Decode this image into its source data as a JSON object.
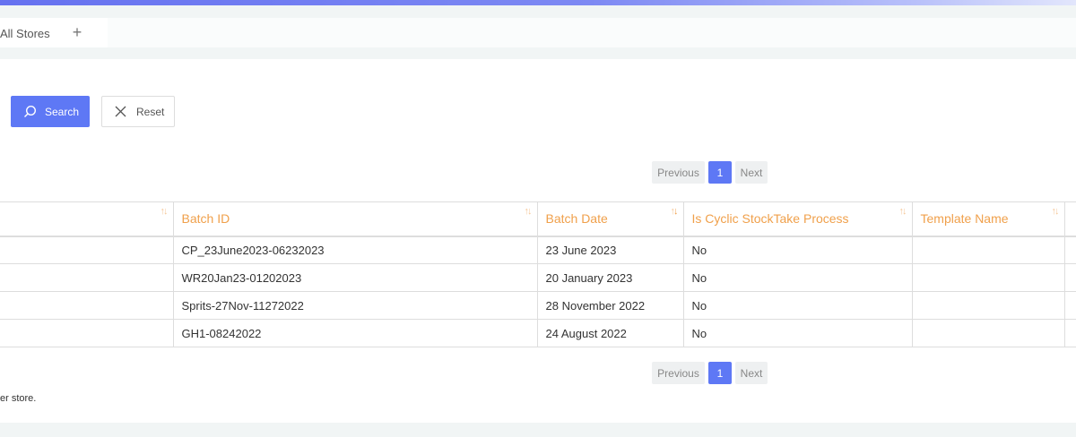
{
  "tabs": {
    "active_label": "All Stores",
    "add_label": "+"
  },
  "actions": {
    "search_label": "Search",
    "reset_label": "Reset"
  },
  "pagination": {
    "previous_label": "Previous",
    "current_page": "1",
    "next_label": "Next"
  },
  "table": {
    "columns": [
      "",
      "Batch ID",
      "Batch Date",
      "Is Cyclic StockTake Process",
      "Template Name",
      ""
    ],
    "rows": [
      {
        "batch_id": "CP_23June2023-06232023",
        "batch_date": "23 June 2023",
        "is_cyclic": "No",
        "template": ""
      },
      {
        "batch_id": "WR20Jan23-01202023",
        "batch_date": "20 January 2023",
        "is_cyclic": "No",
        "template": ""
      },
      {
        "batch_id": "Sprits-27Nov-11272022",
        "batch_date": "28 November 2022",
        "is_cyclic": "No",
        "template": ""
      },
      {
        "batch_id": "GH1-08242022",
        "batch_date": "24 August 2022",
        "is_cyclic": "No",
        "template": ""
      }
    ]
  },
  "footnote": "er store.",
  "colors": {
    "accent": "#5e78f5",
    "header_text": "#f0a04b",
    "topbar_start": "#6672f0"
  },
  "icons": {
    "search": "search-icon",
    "reset": "close-icon",
    "sort": "sort-icon"
  }
}
